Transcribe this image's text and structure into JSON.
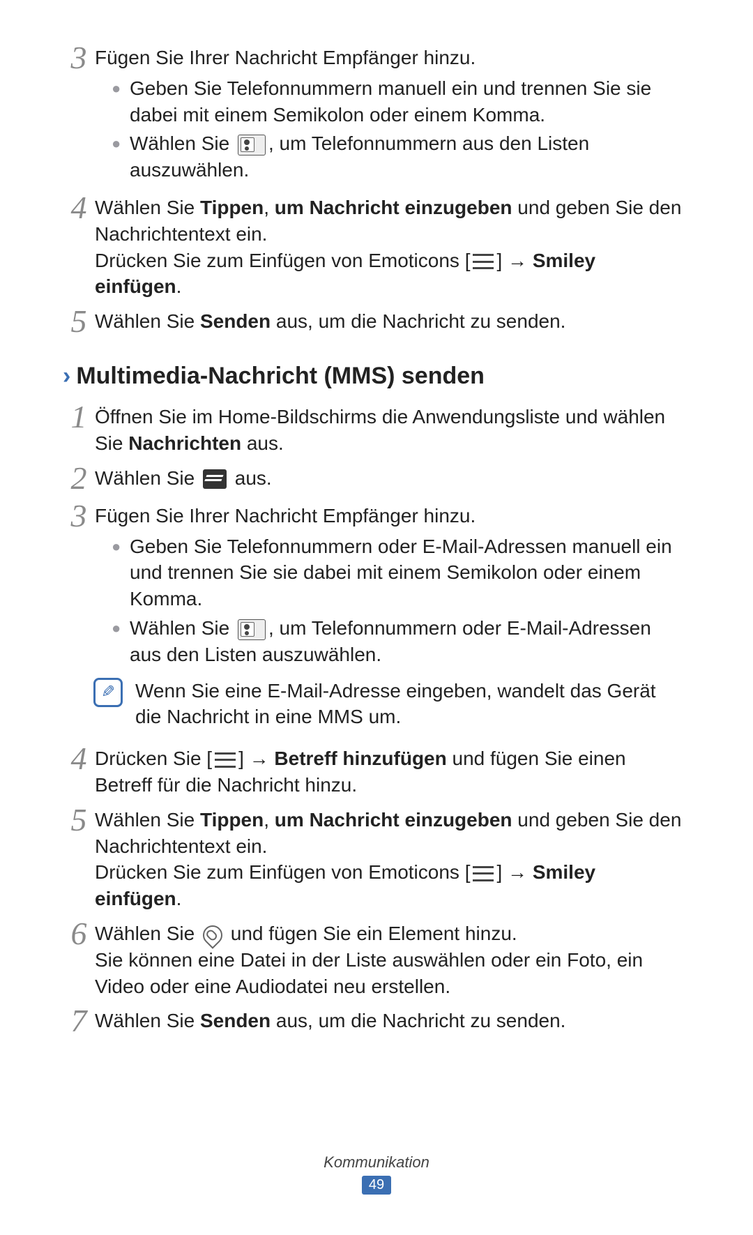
{
  "sec1": {
    "step3": {
      "num": "3",
      "text": "Fügen Sie Ihrer Nachricht Empfänger hinzu.",
      "b1a": "Geben Sie Telefonnummern manuell ein und trennen Sie sie dabei mit einem Semikolon oder einem Komma.",
      "b2a": "Wählen Sie ",
      "b2b": ", um Telefonnummern aus den Listen auszuwählen."
    },
    "step4": {
      "num": "4",
      "t1a": "Wählen Sie ",
      "t1b": "Tippen",
      "t1c": ", ",
      "t1d": "um Nachricht einzugeben",
      "t1e": " und geben Sie den Nachrichtentext ein.",
      "t2a": "Drücken Sie zum Einfügen von Emoticons [",
      "t2b": "] ",
      "t2arrow": "→",
      "t2c": " ",
      "t2d": "Smiley einfügen",
      "t2e": "."
    },
    "step5": {
      "num": "5",
      "a": "Wählen Sie ",
      "b": "Senden",
      "c": " aus, um die Nachricht zu senden."
    }
  },
  "heading": "Multimedia-Nachricht (MMS) senden",
  "sec2": {
    "step1": {
      "num": "1",
      "a": "Öffnen Sie im Home-Bildschirms die Anwendungsliste und wählen Sie ",
      "b": "Nachrichten",
      "c": " aus."
    },
    "step2": {
      "num": "2",
      "a": "Wählen Sie ",
      "b": " aus."
    },
    "step3": {
      "num": "3",
      "text": "Fügen Sie Ihrer Nachricht Empfänger hinzu.",
      "b1": "Geben Sie Telefonnummern oder E-Mail-Adressen manuell ein und trennen Sie sie dabei mit einem Semikolon oder einem Komma.",
      "b2a": "Wählen Sie ",
      "b2b": ", um Telefonnummern oder E-Mail-Adressen aus den Listen auszuwählen."
    },
    "note": "Wenn Sie eine E-Mail-Adresse eingeben, wandelt das Gerät die Nachricht in eine MMS um.",
    "step4": {
      "num": "4",
      "a": "Drücken Sie [",
      "b": "] ",
      "arrow": "→",
      "c": " ",
      "d": "Betreff hinzufügen",
      "e": " und fügen Sie einen Betreff für die Nachricht hinzu."
    },
    "step5": {
      "num": "5",
      "t1a": "Wählen Sie ",
      "t1b": "Tippen",
      "t1c": ", ",
      "t1d": "um Nachricht einzugeben",
      "t1e": " und geben Sie den Nachrichtentext ein.",
      "t2a": "Drücken Sie zum Einfügen von Emoticons [",
      "t2b": "] ",
      "t2arrow": "→",
      "t2c": " ",
      "t2d": "Smiley einfügen",
      "t2e": "."
    },
    "step6": {
      "num": "6",
      "a": "Wählen Sie ",
      "b": " und fügen Sie ein Element hinzu.",
      "c": "Sie können eine Datei in der Liste auswählen oder ein Foto, ein Video oder eine Audiodatei neu erstellen."
    },
    "step7": {
      "num": "7",
      "a": "Wählen Sie ",
      "b": "Senden",
      "c": " aus, um die Nachricht zu senden."
    }
  },
  "footer": {
    "section": "Kommunikation",
    "page": "49"
  }
}
